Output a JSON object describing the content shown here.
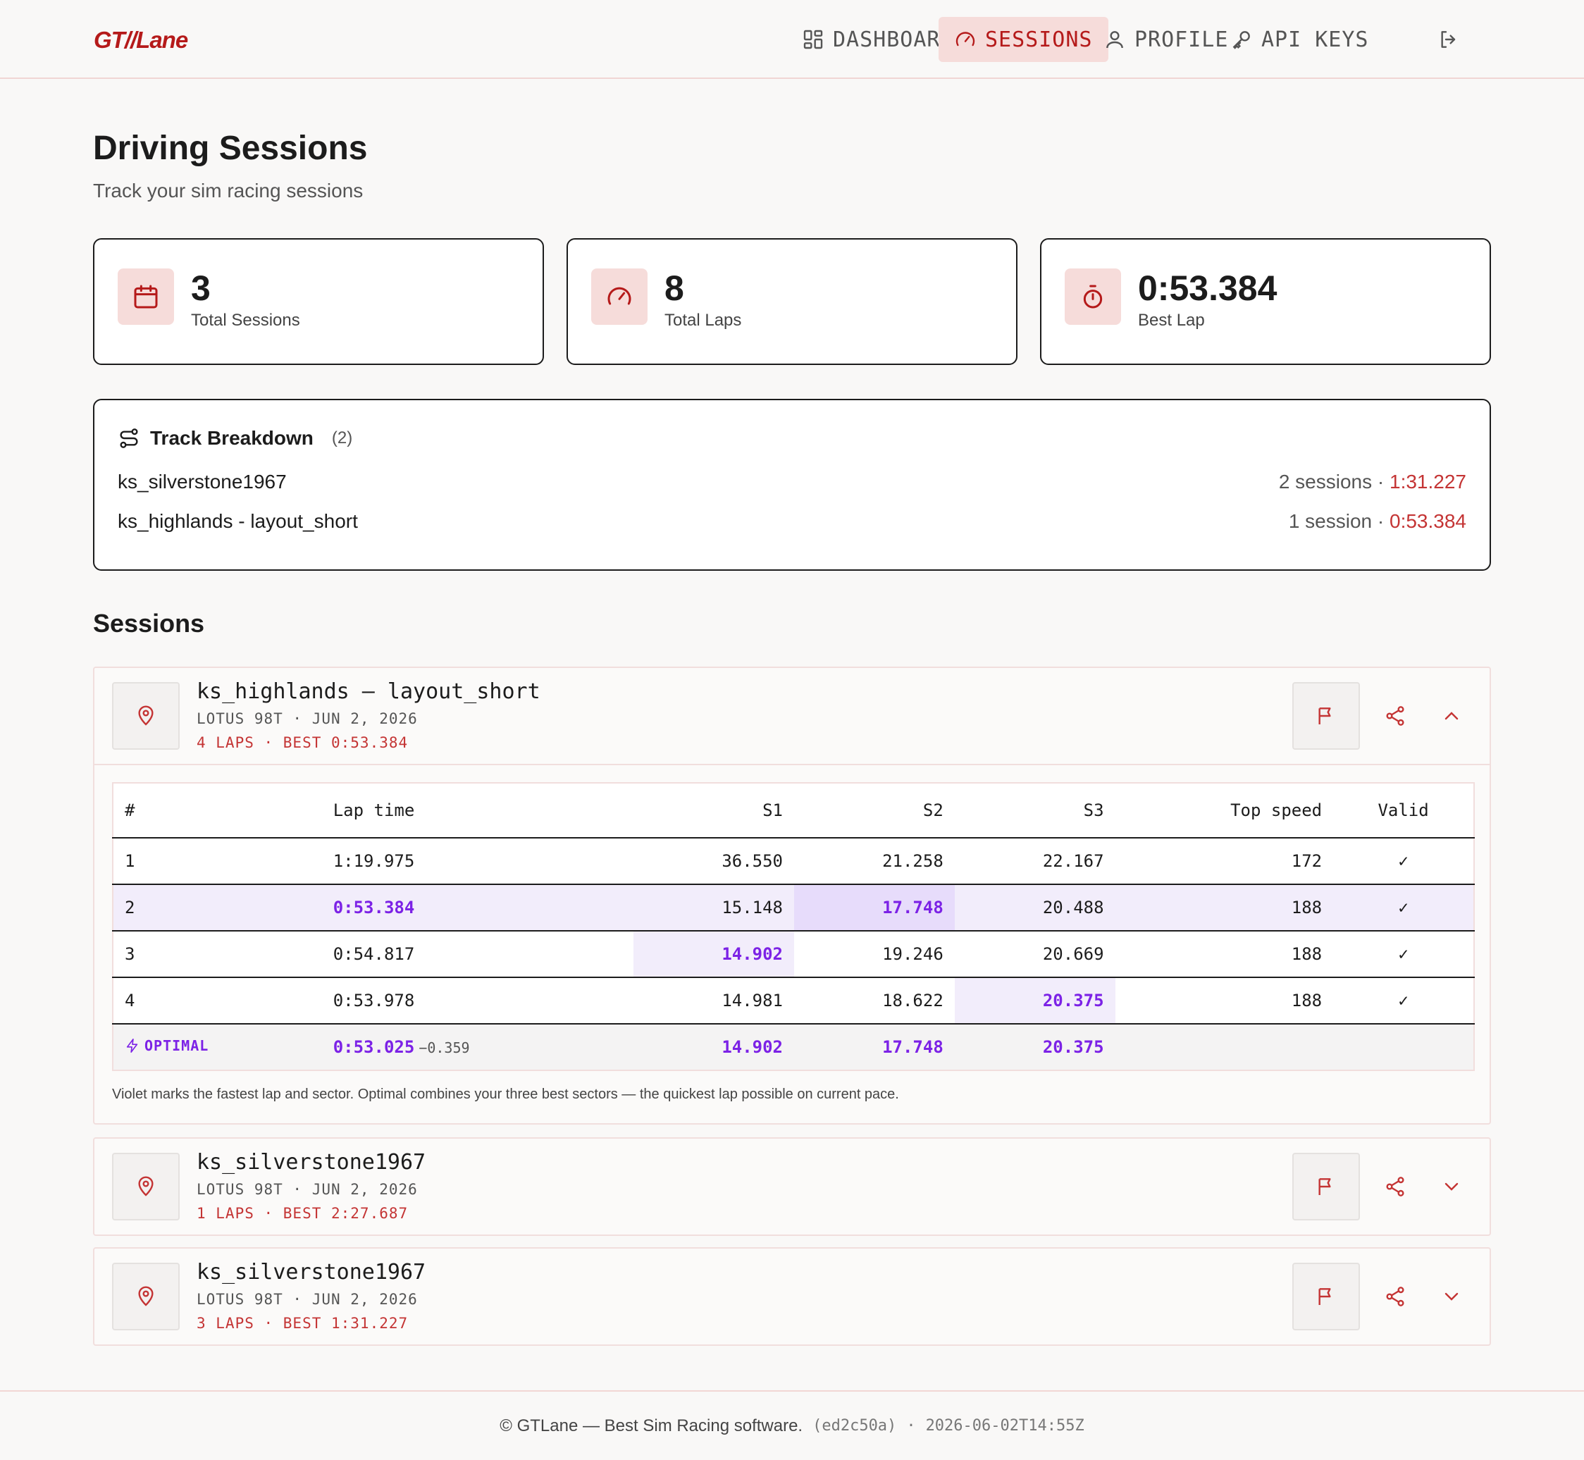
{
  "brand": {
    "logo": "GT//Lane"
  },
  "nav": {
    "dashboard": "DASHBOARD",
    "sessions": "SESSIONS",
    "profile": "PROFILE",
    "api_keys": "API KEYS"
  },
  "page": {
    "title": "Driving Sessions",
    "subtitle": "Track your sim racing sessions"
  },
  "stats": {
    "sessions": {
      "value": "3",
      "label": "Total Sessions"
    },
    "laps": {
      "value": "8",
      "label": "Total Laps"
    },
    "best": {
      "value": "0:53.384",
      "label": "Best Lap"
    }
  },
  "breakdown": {
    "title": "Track Breakdown",
    "count": "(2)",
    "rows": [
      {
        "track": "ks_silverstone1967",
        "meta": "2 sessions · ",
        "best": "1:31.227"
      },
      {
        "track": "ks_highlands - layout_short",
        "meta": "1 session · ",
        "best": "0:53.384"
      }
    ]
  },
  "sessions_title": "Sessions",
  "sessions": [
    {
      "track": "ks_highlands – layout_short",
      "meta": "LOTUS 98T · JUN 2, 2026",
      "stats": "4 LAPS · BEST 0:53.384",
      "expanded": true
    },
    {
      "track": "ks_silverstone1967",
      "meta": "LOTUS 98T · JUN 2, 2026",
      "stats": "1 LAPS · BEST 2:27.687",
      "expanded": false
    },
    {
      "track": "ks_silverstone1967",
      "meta": "LOTUS 98T · JUN 2, 2026",
      "stats": "3 LAPS · BEST 1:31.227",
      "expanded": false
    }
  ],
  "lap_table": {
    "headers": {
      "num": "#",
      "lap": "Lap time",
      "s1": "S1",
      "s2": "S2",
      "s3": "S3",
      "speed": "Top speed",
      "valid": "Valid"
    },
    "rows": [
      {
        "num": "1",
        "lap": "1:19.975",
        "s1": "36.550",
        "s2": "21.258",
        "s3": "22.167",
        "speed": "172",
        "valid": "✓"
      },
      {
        "num": "2",
        "lap": "0:53.384",
        "s1": "15.148",
        "s2": "17.748",
        "s3": "20.488",
        "speed": "188",
        "valid": "✓"
      },
      {
        "num": "3",
        "lap": "0:54.817",
        "s1": "14.902",
        "s2": "19.246",
        "s3": "20.669",
        "speed": "188",
        "valid": "✓"
      },
      {
        "num": "4",
        "lap": "0:53.978",
        "s1": "14.981",
        "s2": "18.622",
        "s3": "20.375",
        "speed": "188",
        "valid": "✓"
      }
    ],
    "optimal": {
      "label": "OPTIMAL",
      "lap": "0:53.025",
      "delta": "−0.359",
      "s1": "14.902",
      "s2": "17.748",
      "s3": "20.375"
    },
    "note": "Violet marks the fastest lap and sector. Optimal combines your three best sectors — the quickest lap possible on current pace."
  },
  "footer": {
    "text": "© GTLane — Best Sim Racing software.",
    "commit": "(ed2c50a)",
    "sep": "·",
    "timestamp": "2026-06-02T14:55Z"
  },
  "colors": {
    "accent": "#b51a1a",
    "fastest": "#7c22e6",
    "card_icon_bg": "#f6dcda"
  }
}
